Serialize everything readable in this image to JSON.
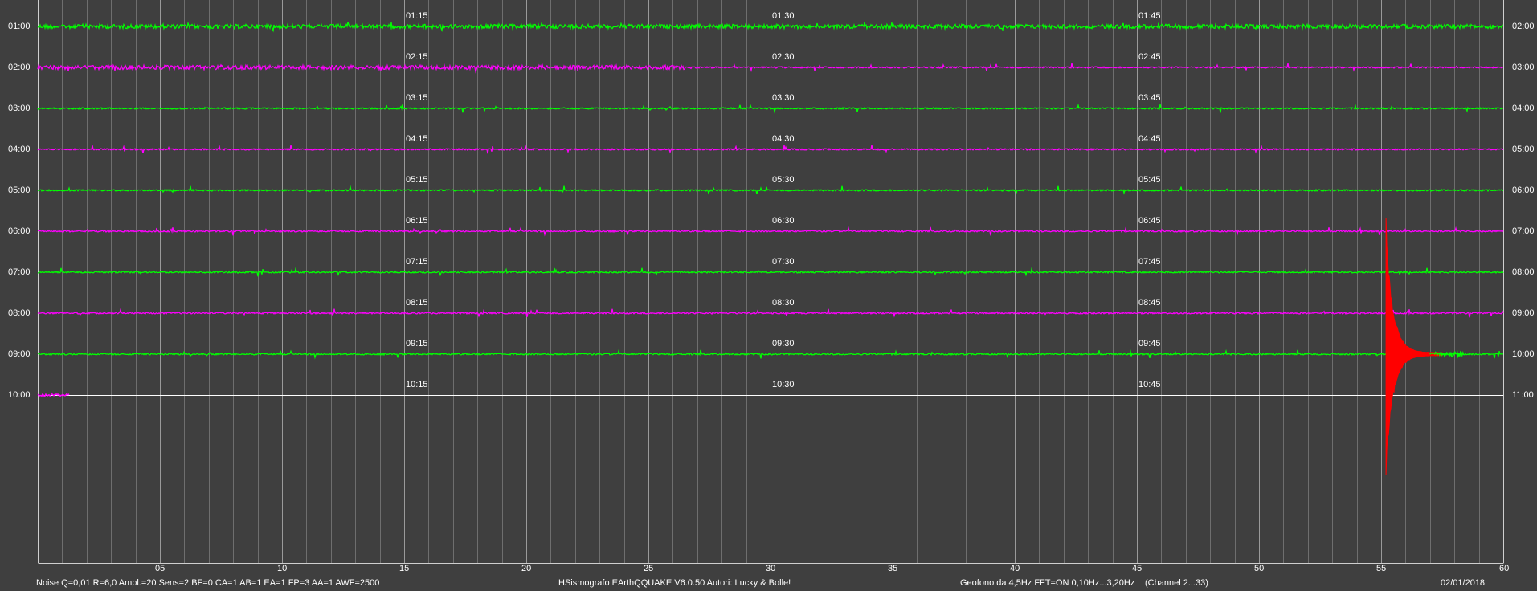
{
  "colors": {
    "background": "#3f3f3f",
    "grid": "#6e6e6e",
    "grid_major": "#9a9a9a",
    "text": "#ffffff",
    "trace_green": "#00ff00",
    "trace_magenta": "#ff00ff",
    "event": "#ff0000"
  },
  "hour_labels_left": [
    "01:00",
    "02:00",
    "03:00",
    "04:00",
    "05:00",
    "06:00",
    "07:00",
    "08:00",
    "09:00",
    "10:00"
  ],
  "hour_labels_right": [
    "02:00",
    "03:00",
    "04:00",
    "05:00",
    "06:00",
    "07:00",
    "08:00",
    "09:00",
    "10:00",
    "11:00"
  ],
  "minute_labels": [
    [
      "01:15",
      "01:30",
      "01:45"
    ],
    [
      "02:15",
      "02:30",
      "02:45"
    ],
    [
      "03:15",
      "03:30",
      "03:45"
    ],
    [
      "04:15",
      "04:30",
      "04:45"
    ],
    [
      "05:15",
      "05:30",
      "05:45"
    ],
    [
      "06:15",
      "06:30",
      "06:45"
    ],
    [
      "07:15",
      "07:30",
      "07:45"
    ],
    [
      "08:15",
      "08:30",
      "08:45"
    ],
    [
      "09:15",
      "09:30",
      "09:45"
    ],
    [
      "10:15",
      "10:30",
      "10:45"
    ]
  ],
  "x_axis_labels": [
    "05",
    "10",
    "15",
    "20",
    "25",
    "30",
    "35",
    "40",
    "45",
    "50",
    "55",
    "60"
  ],
  "event": {
    "row_hour": "09:00",
    "minute": 55.2
  },
  "status_bar": {
    "settings": "Noise Q=0,01 R=6,0 Ampl.=20 Sens=2 BF=0 CA=1 AB=1 EA=1 FP=3 AA=1 AWF=2500",
    "app": "HSismografo EArthQQUAKE  V6.0.50   Autori: Lucky & Bolle!",
    "sensor": "Geofono da 4,5Hz FFT=ON 0,10Hz...3,20Hz",
    "channel": "(Channel 2...33)",
    "date": "02/01/2018"
  }
}
